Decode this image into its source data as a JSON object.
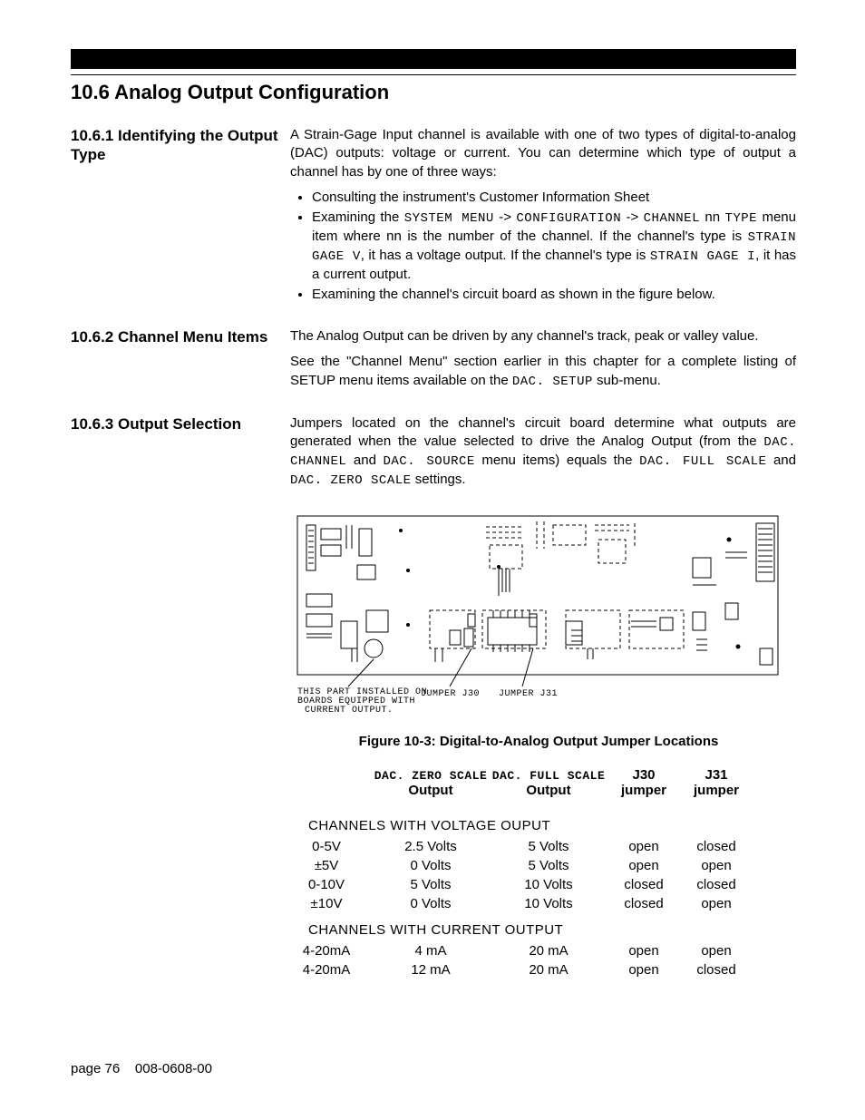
{
  "header": {
    "section_title": "10.6  Analog Output Configuration"
  },
  "s1": {
    "heading": "10.6.1 Identifying the Output Type",
    "p1": "A Strain-Gage Input channel is available with one of two types of digital-to-analog (DAC) outputs: voltage or current.  You can determine which type of output a channel has by one of three ways:",
    "b1": "Consulting the instrument's Customer Information Sheet",
    "b2a": "Examining the ",
    "b2_m1": "SYSTEM MENU",
    "b2b": " -> ",
    "b2_m2": "CONFIGURATION",
    "b2c": " -> ",
    "b2_m3": "CHANNEL",
    "b2d": " nn ",
    "b2_m4": "TYPE",
    "b2e": " menu item where nn is the number of the channel. If the channel's type is ",
    "b2_m5": "STRAIN GAGE V",
    "b2f": ", it has a voltage output. If the channel's type is ",
    "b2_m6": "STRAIN GAGE I",
    "b2g": ", it has a current output.",
    "b3": "Examining the channel's circuit board as shown in the figure below."
  },
  "s2": {
    "heading": "10.6.2 Channel Menu Items",
    "p1": "The Analog Output can be driven by any channel's track, peak or valley value.",
    "p2a": "See the \"Channel Menu\" section earlier in this chapter for a complete listing of SETUP menu items available on the ",
    "p2_m1": "DAC. SETUP",
    "p2b": " sub-menu."
  },
  "s3": {
    "heading": "10.6.3 Output Selection",
    "p1a": "Jumpers located on the channel's circuit board determine what outputs are generated when the value selected to drive the Analog Output (from the ",
    "p1_m1": "DAC. CHANNEL",
    "p1b": " and ",
    "p1_m2": "DAC. SOURCE",
    "p1c": " menu items) equals the ",
    "p1_m3": "DAC. FULL SCALE",
    "p1d": " and ",
    "p1_m4": "DAC. ZERO SCALE",
    "p1e": " settings."
  },
  "figure": {
    "note_l1": "THIS PART INSTALLED ON",
    "note_l2": "BOARDS EQUIPPED WITH",
    "note_l3": "CURRENT OUTPUT.",
    "j30": "JUMPER J30",
    "j31": "JUMPER J31",
    "caption": "Figure 10-3: Digital-to-Analog Output Jumper Locations"
  },
  "table": {
    "h_zero_m": "DAC. ZERO SCALE",
    "h_zero": "Output",
    "h_full_m": "DAC. FULL SCALE",
    "h_full": "Output",
    "h_j30a": "J30",
    "h_j30b": "jumper",
    "h_j31a": "J31",
    "h_j31b": "jumper",
    "sect_v": "CHANNELS WITH VOLTAGE OUPUT",
    "sect_c": "CHANNELS WITH CURRENT OUTPUT",
    "rows_v": [
      {
        "c1": "0-5V",
        "c2": "2.5 Volts",
        "c3": "5 Volts",
        "c4": "open",
        "c5": "closed"
      },
      {
        "c1": "±5V",
        "c2": "0 Volts",
        "c3": "5 Volts",
        "c4": "open",
        "c5": "open"
      },
      {
        "c1": "0-10V",
        "c2": "5 Volts",
        "c3": "10 Volts",
        "c4": "closed",
        "c5": "closed"
      },
      {
        "c1": "±10V",
        "c2": "0 Volts",
        "c3": "10 Volts",
        "c4": "closed",
        "c5": "open"
      }
    ],
    "rows_c": [
      {
        "c1": "4-20mA",
        "c2": "4 mA",
        "c3": "20 mA",
        "c4": "open",
        "c5": "open"
      },
      {
        "c1": "4-20mA",
        "c2": "12 mA",
        "c3": "20 mA",
        "c4": "open",
        "c5": "closed"
      }
    ]
  },
  "footer": {
    "page": "page 76",
    "doc": "008-0608-00"
  }
}
